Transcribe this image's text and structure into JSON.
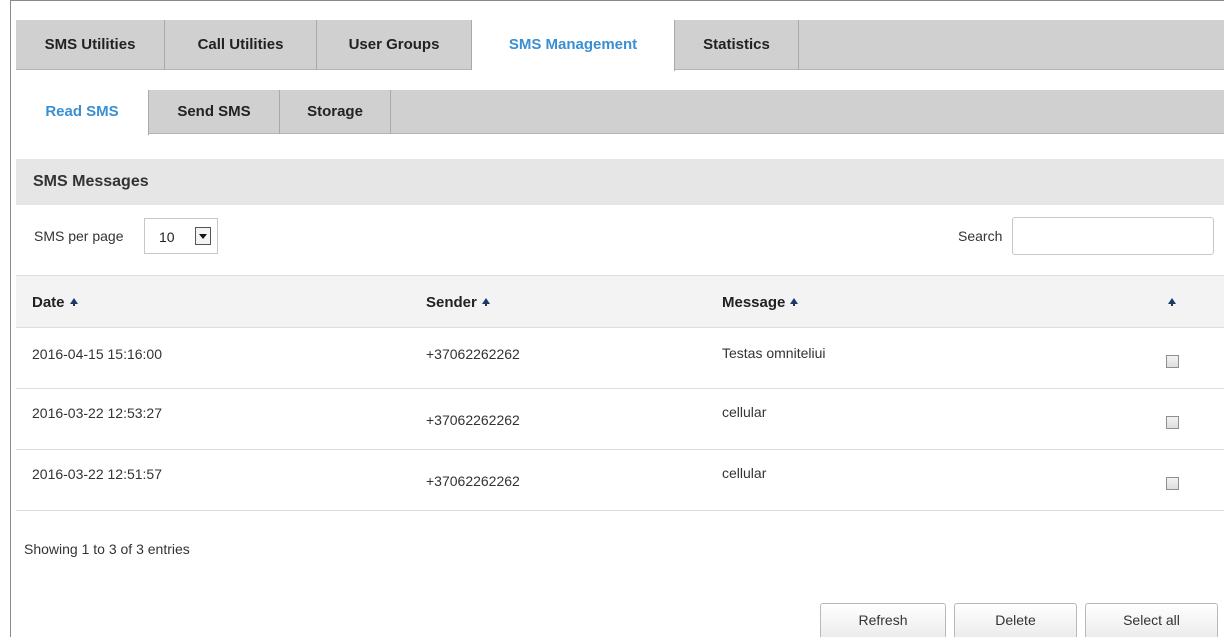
{
  "top_tabs": [
    {
      "label": "SMS Utilities",
      "active": false
    },
    {
      "label": "Call Utilities",
      "active": false
    },
    {
      "label": "User Groups",
      "active": false
    },
    {
      "label": "SMS Management",
      "active": true
    },
    {
      "label": "Statistics",
      "active": false
    }
  ],
  "sub_tabs": [
    {
      "label": "Read SMS",
      "active": true
    },
    {
      "label": "Send SMS",
      "active": false
    },
    {
      "label": "Storage",
      "active": false
    }
  ],
  "section": {
    "title": "SMS Messages"
  },
  "controls": {
    "per_page_label": "SMS per page",
    "per_page_value": "10",
    "search_label": "Search",
    "search_value": ""
  },
  "table": {
    "columns": [
      "Date",
      "Sender",
      "Message",
      ""
    ],
    "rows": [
      {
        "date": "2016-04-15 15:16:00",
        "sender": "+37062262262",
        "message": "Testas omniteliui",
        "checked": false
      },
      {
        "date": "2016-03-22 12:53:27",
        "sender": "+37062262262",
        "message": "cellular",
        "checked": false
      },
      {
        "date": "2016-03-22 12:51:57",
        "sender": "+37062262262",
        "message": "cellular",
        "checked": false
      }
    ]
  },
  "footer": {
    "showing_text": "Showing 1 to 3 of 3 entries"
  },
  "buttons": {
    "refresh": "Refresh",
    "delete": "Delete",
    "select_all": "Select all"
  },
  "colors": {
    "accent": "#3a8fd2",
    "tab_bg": "#d0d0d0",
    "section_bg": "#e6e6e6",
    "sort_icon": "#1b3a66"
  }
}
